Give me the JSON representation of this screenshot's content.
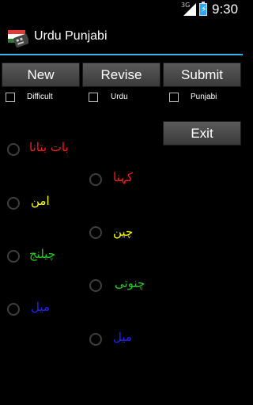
{
  "status_bar": {
    "network": "3G",
    "time": "9:30"
  },
  "action_bar": {
    "app_icon": "flag-keyboard-icon",
    "title": "Urdu Punjabi"
  },
  "buttons": {
    "new_label": "New",
    "revise_label": "Revise",
    "submit_label": "Submit",
    "exit_label": "Exit"
  },
  "checkboxes": [
    {
      "label": "Difficult",
      "checked": false
    },
    {
      "label": "Urdu",
      "checked": false
    },
    {
      "label": "Punjabi",
      "checked": false
    }
  ],
  "options": [
    {
      "text": "بات بتانا",
      "color": "#ff1a1a"
    },
    {
      "text": "کہنا",
      "color": "#ff1a1a"
    },
    {
      "text": "امن",
      "color": "#ffff00"
    },
    {
      "text": "چین",
      "color": "#ffff00"
    },
    {
      "text": "چیلنج",
      "color": "#22cc22"
    },
    {
      "text": "چنوتی",
      "color": "#22cc22"
    },
    {
      "text": "میل",
      "color": "#2222ff"
    },
    {
      "text": "میل",
      "color": "#2222ff"
    }
  ]
}
